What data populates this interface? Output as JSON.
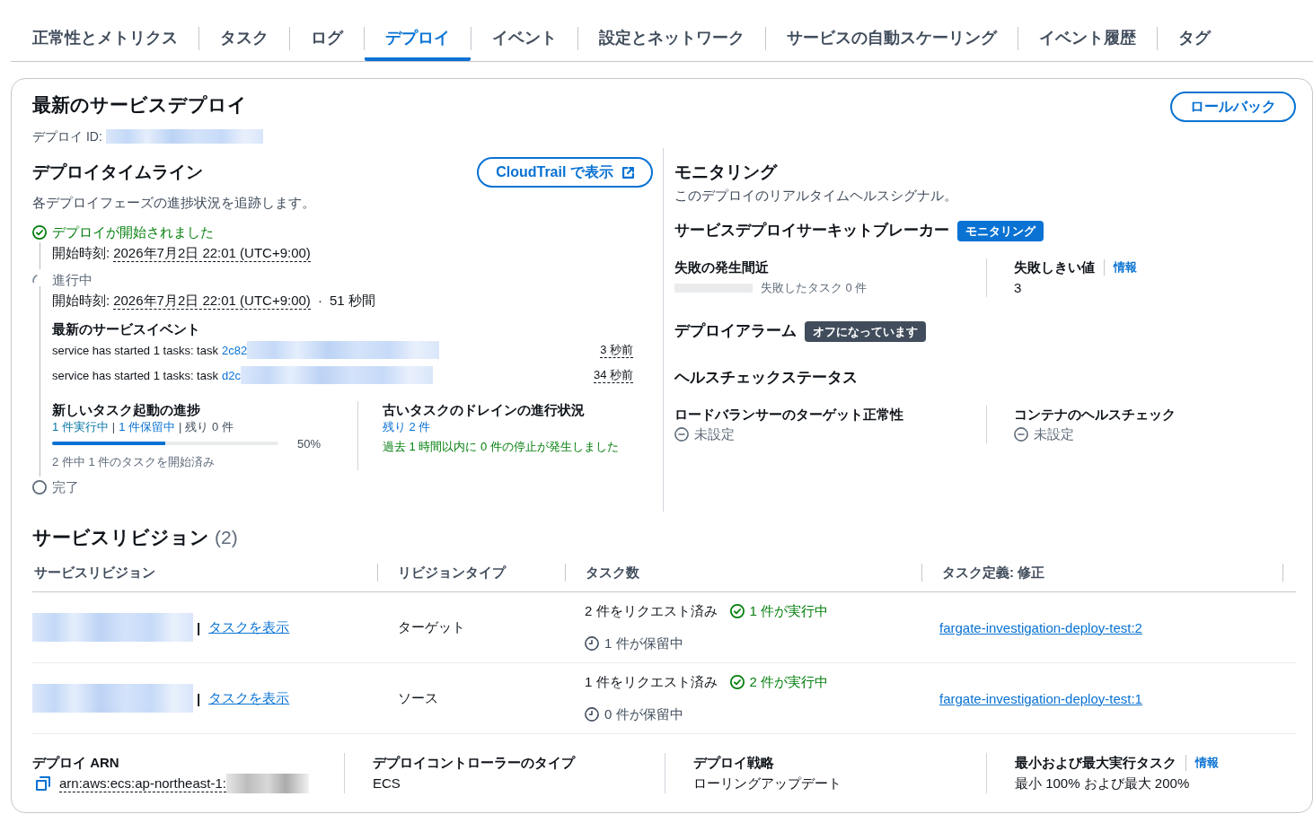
{
  "tabs": [
    {
      "label": "正常性とメトリクス",
      "selected": false
    },
    {
      "label": "タスク",
      "selected": false
    },
    {
      "label": "ログ",
      "selected": false
    },
    {
      "label": "デプロイ",
      "selected": true
    },
    {
      "label": "イベント",
      "selected": false
    },
    {
      "label": "設定とネットワーク",
      "selected": false
    },
    {
      "label": "サービスの自動スケーリング",
      "selected": false
    },
    {
      "label": "イベント履歴",
      "selected": false
    },
    {
      "label": "タグ",
      "selected": false
    }
  ],
  "deployment": {
    "title": "最新のサービスデプロイ",
    "id_label": "デプロイ ID:",
    "rollback_button": "ロールバック"
  },
  "timeline": {
    "title": "デプロイタイムライン",
    "cloudtrail_button": "CloudTrail で表示",
    "description": "各デプロイフェーズの進捗状況を追跡します。",
    "steps": [
      {
        "kind": "completed",
        "label": "デプロイが開始されました",
        "start_label": "開始時刻:",
        "start_time": "2026年7月2日 22:01 (UTC+9:00)"
      },
      {
        "kind": "running",
        "label": "進行中",
        "start_label": "開始時刻:",
        "start_time": "2026年7月2日 22:01 (UTC+9:00)",
        "separator": "·",
        "duration": "51 秒間",
        "events": {
          "title": "最新のサービスイベント",
          "items": [
            {
              "message": "service has started 1 tasks: task",
              "task_link": "2c82",
              "time": "3 秒前"
            },
            {
              "message": "service has started 1 tasks: task",
              "task_link": "d2c",
              "time": "34 秒前"
            }
          ]
        },
        "launch": {
          "title": "新しいタスク起動の進捗",
          "summary": [
            {
              "kind": "running",
              "text": "1 件実行中"
            },
            {
              "kind": "separator",
              "text": "|"
            },
            {
              "kind": "pending",
              "text": "1 件保留中"
            },
            {
              "kind": "separator",
              "text": "|"
            },
            {
              "kind": "remaining",
              "text": "残り 0 件"
            }
          ],
          "level": 0.5,
          "reading": "50%",
          "caption": "2 件中 1 件のタスクを開始済み"
        },
        "drain": {
          "title": "古いタスクのドレインの進行状況",
          "remaining": "残り 2 件",
          "note": "過去 1 時間以内に 0 件の停止が発生しました"
        }
      },
      {
        "kind": "upcoming",
        "label": "完了"
      }
    ]
  },
  "monitoring": {
    "title": "モニタリング",
    "description": "このデプロイのリアルタイムヘルスシグナル。",
    "circuit_breaker": {
      "title": "サービスデプロイサーキットブレーカー",
      "badge": {
        "kind": "active",
        "text": "モニタリング"
      },
      "failures": {
        "label": "失敗の発生間近",
        "level": 0,
        "reading": "失敗したタスク 0 件"
      },
      "threshold": {
        "label": "失敗しきい値",
        "info_link": "情報",
        "value": "3"
      }
    },
    "alarms": {
      "title": "デプロイアラーム",
      "badge": {
        "kind": "off",
        "text": "オフになっています"
      }
    },
    "health": {
      "title": "ヘルスチェックステータス",
      "checks": [
        {
          "kind": "unset",
          "label": "ロードバランサーのターゲット正常性",
          "value": "未設定"
        },
        {
          "kind": "unset",
          "label": "コンテナのヘルスチェック",
          "value": "未設定"
        }
      ]
    }
  },
  "revisions": {
    "title": "サービスリビジョン",
    "count": "(2)",
    "columns": [
      "サービスリビジョン",
      "リビジョンタイプ",
      "タスク数",
      "タスク定義: 修正"
    ],
    "rows": [
      {
        "separator": "|",
        "view_tasks_link": "タスクを表示",
        "type": "ターゲット",
        "requested": "2 件をリクエスト済み",
        "running": "1 件が実行中",
        "pending": "1 件が保留中",
        "task_definition": "fargate-investigation-deploy-test:2"
      },
      {
        "separator": "|",
        "view_tasks_link": "タスクを表示",
        "type": "ソース",
        "requested": "1 件をリクエスト済み",
        "running": "2 件が実行中",
        "pending": "0 件が保留中",
        "task_definition": "fargate-investigation-deploy-test:1"
      }
    ]
  },
  "details": [
    {
      "kind": "arn",
      "label": "デプロイ ARN",
      "value": "arn:aws:ecs:ap-northeast-1:"
    },
    {
      "kind": "text",
      "label": "デプロイコントローラーのタイプ",
      "value": "ECS"
    },
    {
      "kind": "text",
      "label": "デプロイ戦略",
      "value": "ローリングアップデート"
    },
    {
      "kind": "text",
      "label": "最小および最大実行タスク",
      "info_link": "情報",
      "value": "最小 100% および最大 200%"
    }
  ]
}
